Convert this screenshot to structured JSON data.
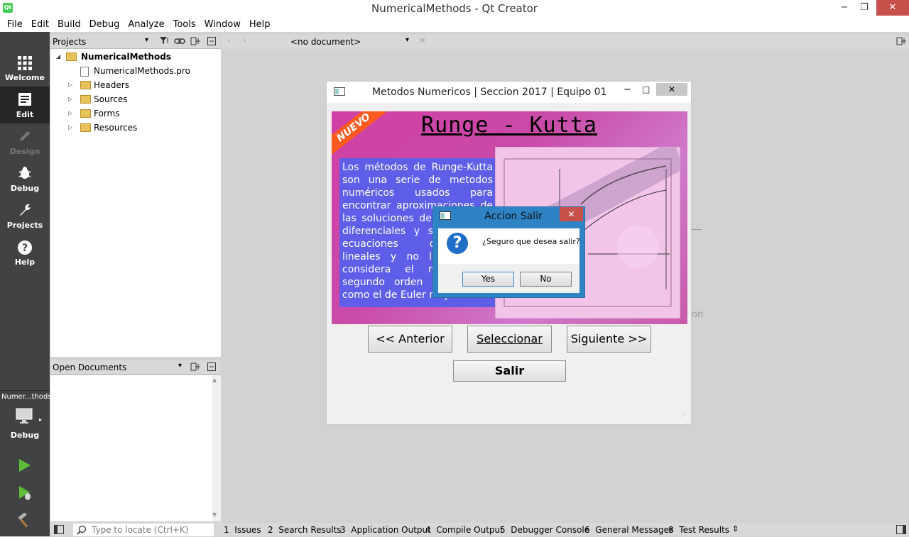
{
  "window": {
    "title": "NumericalMethods - Qt Creator",
    "min": "−",
    "max": "❐",
    "close": "✕"
  },
  "menubar": [
    "File",
    "Edit",
    "Build",
    "Debug",
    "Analyze",
    "Tools",
    "Window",
    "Help"
  ],
  "modes": [
    {
      "label": "Welcome",
      "icon": "grid-icon"
    },
    {
      "label": "Edit",
      "icon": "document-icon"
    },
    {
      "label": "Design",
      "icon": "pen-icon"
    },
    {
      "label": "Debug",
      "icon": "bug-icon"
    },
    {
      "label": "Projects",
      "icon": "wrench-icon"
    },
    {
      "label": "Help",
      "icon": "help-icon"
    }
  ],
  "kit": {
    "project": "Numer...thods",
    "config": "Debug"
  },
  "projects_pane": {
    "title": "Projects",
    "root": "NumericalMethods",
    "items": [
      "NumericalMethods.pro",
      "Headers",
      "Sources",
      "Forms",
      "Resources"
    ]
  },
  "open_documents": {
    "title": "Open Documents"
  },
  "editor": {
    "no_document": "<no document>",
    "bg_text": "on"
  },
  "app": {
    "title": "Metodos Numericos | Seccion 2017 | Equipo 01",
    "badge": "NUEVO",
    "heading": "Runge - Kutta",
    "description": "Los métodos de Runge-Kutta son una serie de metodos numéricos usados para encontrar aproximaciones de las soluciones de ecuaciones diferenciales y sistemas de ecuaciones diferenciales lineales y no lineales. Se considera el método de segundo orden considerado como el de Euler mejorado.",
    "buttons": {
      "prev": "<< Anterior",
      "select": "Seleccionar",
      "next": "Siguiente >>",
      "exit": "Salir"
    }
  },
  "dialog": {
    "title": "Accion Salir",
    "message": "¿Seguro que desea salir?",
    "yes": "Yes",
    "no": "No",
    "close": "✕"
  },
  "locator": {
    "placeholder": "Type to locate (Ctrl+K)"
  },
  "output_tabs": [
    {
      "num": "1",
      "label": "Issues"
    },
    {
      "num": "2",
      "label": "Search Results"
    },
    {
      "num": "3",
      "label": "Application Output"
    },
    {
      "num": "4",
      "label": "Compile Output"
    },
    {
      "num": "5",
      "label": "Debugger Console"
    },
    {
      "num": "6",
      "label": "General Messages"
    },
    {
      "num": "8",
      "label": "Test Results"
    }
  ]
}
